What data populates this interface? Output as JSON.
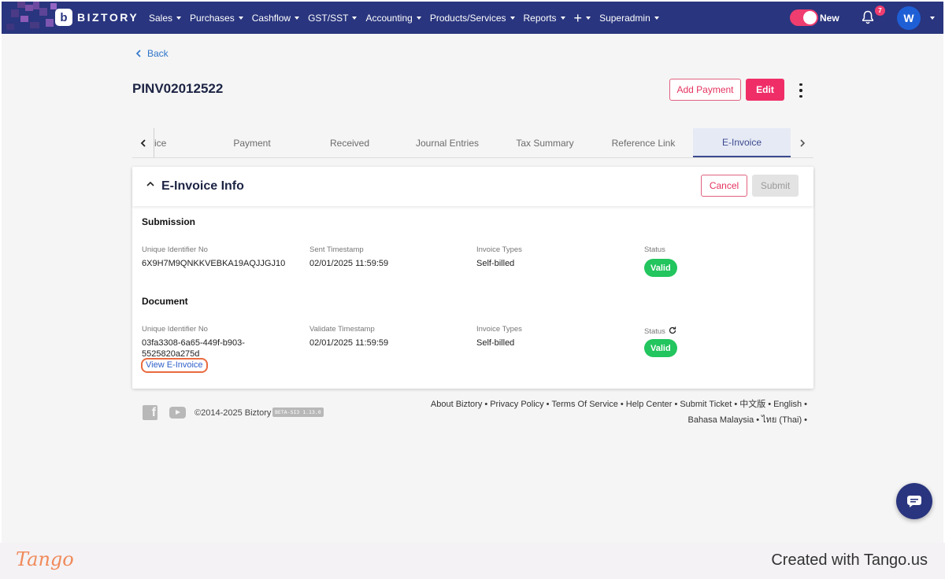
{
  "nav": {
    "brand": "BIZTORY",
    "menu": [
      {
        "label": "Sales"
      },
      {
        "label": "Purchases"
      },
      {
        "label": "Cashflow"
      },
      {
        "label": "GST/SST"
      },
      {
        "label": "Accounting"
      },
      {
        "label": "Products/Services"
      },
      {
        "label": "Reports"
      },
      {
        "label": "+"
      },
      {
        "label": "Superadmin"
      }
    ],
    "toggle_label": "New",
    "notification_count": "7",
    "avatar_initial": "W",
    "colors": {
      "nav_bg": "#29357e",
      "accent": "#ef2e68"
    }
  },
  "back_label": "Back",
  "invoice": {
    "title": "PINV02012522",
    "add_payment_label": "Add Payment",
    "edit_label": "Edit"
  },
  "tabs": [
    {
      "label": "ice"
    },
    {
      "label": "Payment"
    },
    {
      "label": "Received"
    },
    {
      "label": "Journal Entries"
    },
    {
      "label": "Tax Summary"
    },
    {
      "label": "Reference Link"
    },
    {
      "label": "E-Invoice",
      "active": true
    }
  ],
  "einvoice": {
    "title": "E-Invoice Info",
    "cancel_label": "Cancel",
    "submit_label": "Submit",
    "submission": {
      "title": "Submission",
      "uid_label": "Unique Identifier No",
      "uid_value": "6X9H7M9QNKKVEBKA19AQJJGJ10",
      "ts_label": "Sent Timestamp",
      "ts_value": "02/01/2025 11:59:59",
      "type_label": "Invoice Types",
      "type_value": "Self-billed",
      "status_label": "Status",
      "status_value": "Valid"
    },
    "document": {
      "title": "Document",
      "uid_label": "Unique Identifier No",
      "uid_value_line1": "03fa3308-6a65-449f-b903-",
      "uid_value_line2": "5525820a275d",
      "view_link": "View E-Invoice",
      "ts_label": "Validate Timestamp",
      "ts_value": "02/01/2025 11:59:59",
      "type_label": "Invoice Types",
      "type_value": "Self-billed",
      "status_label": "Status",
      "status_value": "Valid"
    }
  },
  "footer": {
    "copyright": "©2014-2025 Biztory",
    "beta": "BETA-SI3 1.13.0",
    "links_line1": [
      "About Biztory",
      "Privacy Policy",
      "Terms Of Service",
      "Help Center",
      "Submit Ticket",
      "中文版",
      "English"
    ],
    "links_line2": [
      "Bahasa Malaysia",
      "ไทย (Thai)"
    ]
  },
  "tango": {
    "logo": "Tango",
    "created": "Created with Tango.us"
  }
}
